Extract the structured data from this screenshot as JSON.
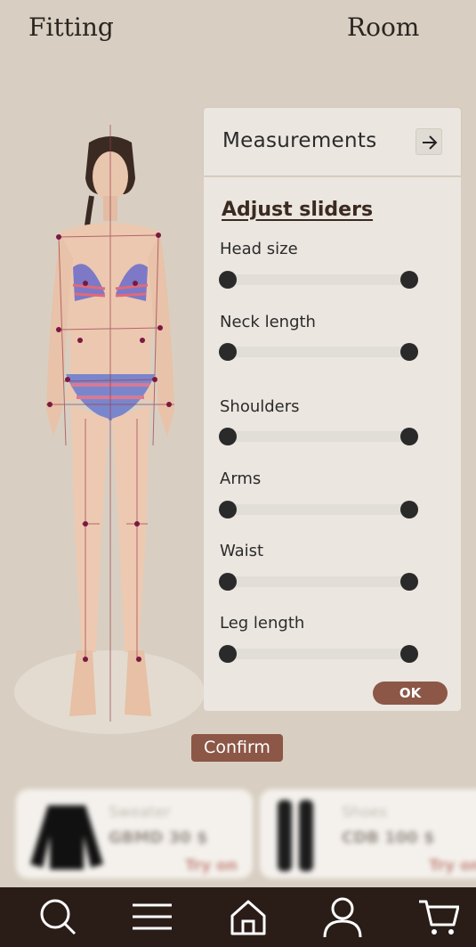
{
  "header": {
    "title_left": "Fitting",
    "title_right": "Room"
  },
  "panel": {
    "header_label": "Measurements",
    "adjust_title": "Adjust sliders",
    "sliders": [
      {
        "label": "Head size"
      },
      {
        "label": "Neck length"
      },
      {
        "label": "Shoulders"
      },
      {
        "label": "Arms"
      },
      {
        "label": "Waist"
      },
      {
        "label": "Leg length"
      }
    ],
    "ok_label": "OK"
  },
  "confirm_label": "Confirm",
  "products": [
    {
      "name": "Sweater",
      "price": "GBMD 30 $",
      "action": "Try on"
    },
    {
      "name": "Shoes",
      "price": "CDB 100 $",
      "action": "Try on"
    }
  ],
  "nav": [
    "search-icon",
    "menu-icon",
    "home-icon",
    "profile-icon",
    "cart-icon"
  ],
  "colors": {
    "accent": "#8c5746",
    "background": "#d8cfc2",
    "nav_bg": "#2a1c17",
    "panel_bg": "#ebe6e0"
  }
}
